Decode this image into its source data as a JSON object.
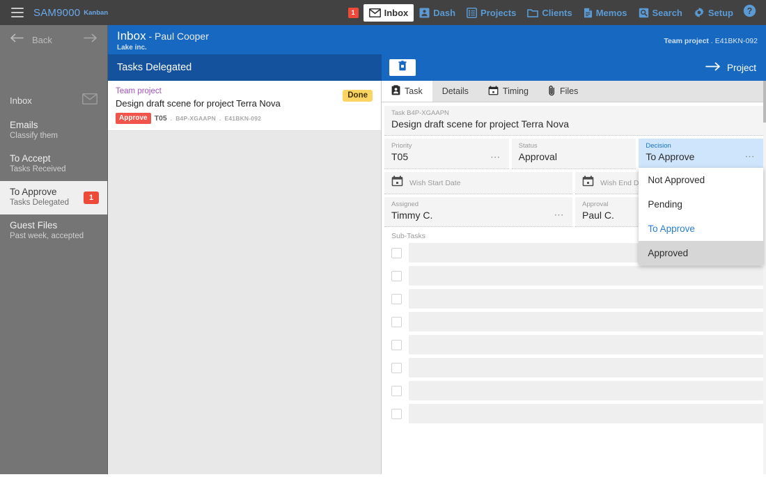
{
  "topnav": {
    "brand": "SAM9000",
    "brand_sub": "Kanban",
    "notification_count": "1",
    "items": [
      {
        "label": "Inbox",
        "icon": "envelope-icon",
        "active": true
      },
      {
        "label": "Dash",
        "icon": "contact-card-icon",
        "active": false
      },
      {
        "label": "Projects",
        "icon": "list-icon",
        "active": false
      },
      {
        "label": "Clients",
        "icon": "folder-icon",
        "active": false
      },
      {
        "label": "Memos",
        "icon": "document-icon",
        "active": false
      },
      {
        "label": "Search",
        "icon": "search-icon",
        "active": false
      },
      {
        "label": "Setup",
        "icon": "gear-icon",
        "active": false
      }
    ],
    "help_icon": "help-circle-icon"
  },
  "sidebar": {
    "back_label": "Back",
    "inbox_label": "Inbox",
    "inbox_icon": "envelope-icon",
    "items": [
      {
        "title": "Emails",
        "subtitle": "Classify them",
        "count": "",
        "active": false
      },
      {
        "title": "To Accept",
        "subtitle": "Tasks Received",
        "count": "",
        "active": false
      },
      {
        "title": "To Approve",
        "subtitle": "Tasks Delegated",
        "count": "1",
        "active": true
      },
      {
        "title": "Guest Files",
        "subtitle": "Past week, accepted",
        "count": "",
        "active": false
      }
    ]
  },
  "header": {
    "title": "Inbox",
    "title_sep": " - ",
    "user": "Paul Cooper",
    "company": "Lake inc.",
    "context_label": "Team project",
    "context_sep": " . ",
    "context_code": "E41BKN-092",
    "bar_title": "Tasks Delegated",
    "trash_icon": "trash-icon",
    "project_link": "Project",
    "project_arrow_icon": "arrow-right-icon"
  },
  "list": {
    "cards": [
      {
        "project": "Team project",
        "title": "Design draft scene for project Terra Nova",
        "chip": "Approve",
        "code": "T05",
        "sep1": " . ",
        "ref1": "B4P-XGAAPN",
        "sep2": " . ",
        "ref2": "E41BKN-092",
        "status_badge": "Done"
      }
    ]
  },
  "detail": {
    "tabs": [
      {
        "label": "Task",
        "icon": "clipboard-icon",
        "active": true
      },
      {
        "label": "Details",
        "icon": "",
        "active": false
      },
      {
        "label": "Timing",
        "icon": "calendar-icon",
        "active": false
      },
      {
        "label": "Files",
        "icon": "paperclip-icon",
        "active": false
      }
    ],
    "task": {
      "label": "Task B4P-XGAAPN",
      "value": "Design draft scene for project Terra Nova"
    },
    "priority": {
      "label": "Priority",
      "value": "T05"
    },
    "status": {
      "label": "Status",
      "value": "Approval"
    },
    "decision": {
      "label": "Decision",
      "value": "To Approve",
      "options": [
        {
          "label": "Not Approved",
          "state": ""
        },
        {
          "label": "Pending",
          "state": ""
        },
        {
          "label": "To Approve",
          "state": "selected"
        },
        {
          "label": "Approved",
          "state": "hovered"
        }
      ]
    },
    "wish_start": {
      "placeholder": "Wish Start Date",
      "icon": "calendar-icon"
    },
    "wish_end": {
      "placeholder": "Wish End Date",
      "icon": "calendar-icon"
    },
    "assigned": {
      "label": "Assigned",
      "value": "Timmy C."
    },
    "approval": {
      "label": "Approval",
      "value": "Paul C."
    },
    "subtasks": {
      "label": "Sub-Tasks",
      "rows": [
        "",
        "",
        "",
        "",
        "",
        "",
        "",
        ""
      ]
    }
  },
  "colors": {
    "nav_bg": "#424242",
    "nav_accent": "#5b9bd5",
    "header_blue": "#1668c1",
    "header_blue_dark": "#14529e",
    "sidebar_bg": "#757575",
    "badge_red": "#ee4a3a",
    "chip_approve": "#f0544a",
    "chip_done": "#fcd462",
    "project_purple": "#a14fb8",
    "decision_highlight": "#cfe5fb",
    "decision_accent": "#1a73c7"
  }
}
